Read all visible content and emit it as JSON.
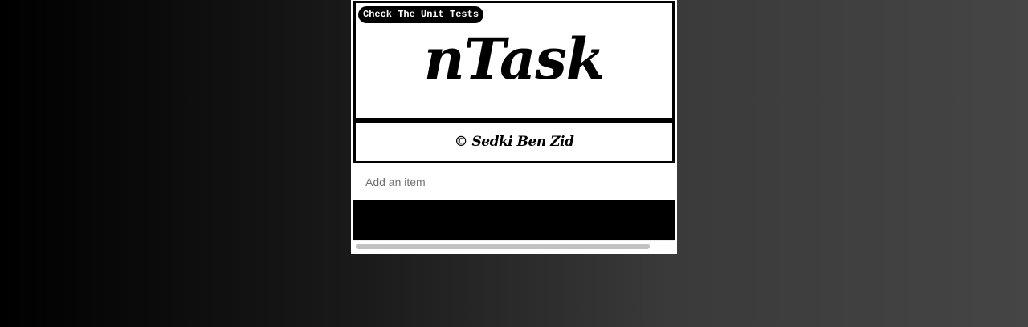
{
  "header": {
    "unit_tests_button": "Check The Unit Tests",
    "app_title": "nTask"
  },
  "footer": {
    "copyright": "© Sedki Ben Zid"
  },
  "add_item": {
    "placeholder": "Add an item",
    "value": ""
  },
  "colors": {
    "primary": "#000000",
    "surface": "#ffffff"
  }
}
